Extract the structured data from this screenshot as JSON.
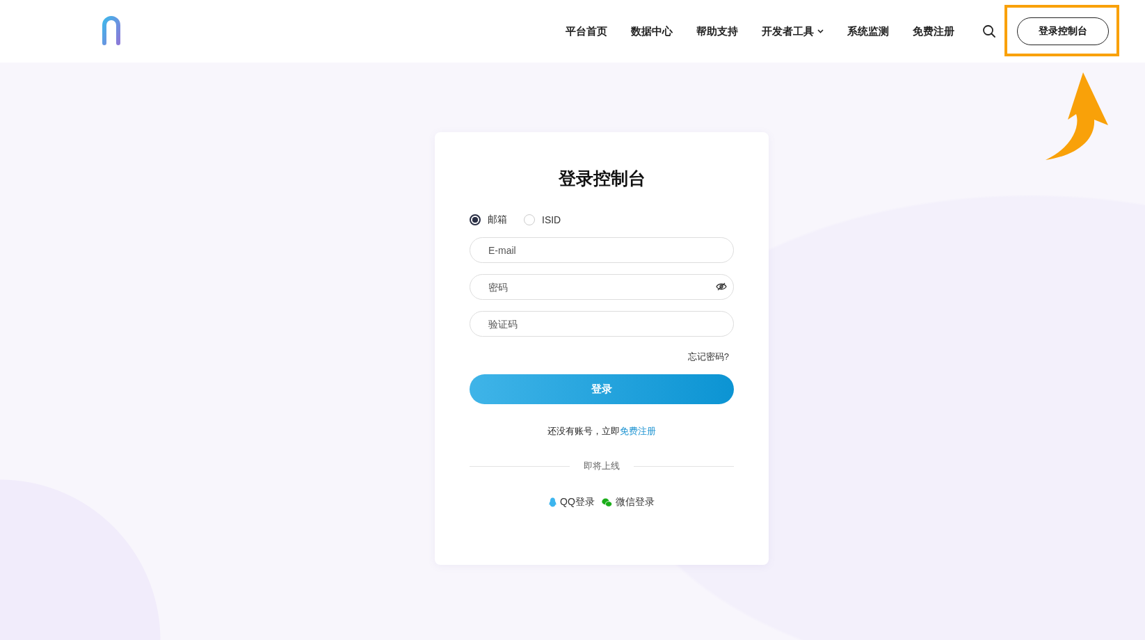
{
  "nav": {
    "items": [
      {
        "label": "平台首页",
        "dropdown": false
      },
      {
        "label": "数据中心",
        "dropdown": false
      },
      {
        "label": "帮助支持",
        "dropdown": false
      },
      {
        "label": "开发者工具",
        "dropdown": true
      },
      {
        "label": "系统监测",
        "dropdown": false
      },
      {
        "label": "免费注册",
        "dropdown": false
      }
    ],
    "console_button": "登录控制台"
  },
  "login": {
    "title": "登录控制台",
    "methods": [
      {
        "label": "邮箱",
        "selected": true
      },
      {
        "label": "ISID",
        "selected": false
      }
    ],
    "fields": [
      {
        "placeholder": "E-mail",
        "kind": "text"
      },
      {
        "placeholder": "密码",
        "kind": "password"
      },
      {
        "placeholder": "验证码",
        "kind": "text"
      }
    ],
    "forgot": "忘记密码?",
    "submit": "登录",
    "signup_prompt": "还没有账号，立即",
    "signup_link": "免费注册",
    "divider": "即将上线",
    "social": [
      {
        "kind": "qq",
        "label": "QQ登录"
      },
      {
        "kind": "wechat",
        "label": "微信登录"
      }
    ]
  }
}
